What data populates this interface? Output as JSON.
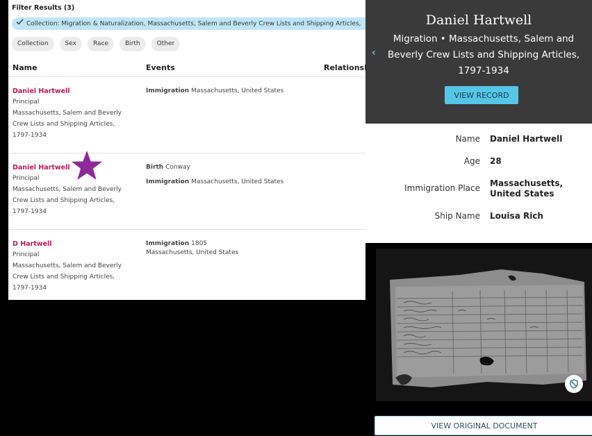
{
  "filter": {
    "title": "Filter Results (3)",
    "active_chip": "Collection: Migration & Naturalization, Massachusetts, Salem and Beverly Crew Lists and Shipping Articles,",
    "chips": [
      "Collection",
      "Sex",
      "Race",
      "Birth",
      "Other"
    ]
  },
  "columns": {
    "name": "Name",
    "events": "Events",
    "relationship": "Relationsh"
  },
  "results": [
    {
      "name": "Daniel Hartwell",
      "role": "Principal",
      "collection_lines": [
        "Massachusetts, Salem and Beverly",
        "Crew Lists and Shipping Articles,",
        "1797-1934"
      ],
      "events": [
        {
          "type": "Immigration",
          "detail": "Massachusetts, United States"
        }
      ]
    },
    {
      "name": "Daniel Hartwell",
      "role": "Principal",
      "collection_lines": [
        "Massachusetts, Salem and Beverly",
        "Crew Lists and Shipping Articles,",
        "1797-1934"
      ],
      "events": [
        {
          "type": "Birth",
          "detail": "Conway"
        },
        {
          "type": "Immigration",
          "detail": "Massachusetts, United States"
        }
      ]
    },
    {
      "name": "D Hartwell",
      "role": "Principal",
      "collection_lines": [
        "Massachusetts, Salem and Beverly",
        "Crew Lists and Shipping Articles,",
        "1797-1934"
      ],
      "events": [
        {
          "type": "Immigration",
          "detail": "1805",
          "detail2": "Massachusetts, United States"
        }
      ]
    }
  ],
  "record": {
    "title": "Daniel Hartwell",
    "subtitle": "Migration • Massachusetts, Salem and Beverly Crew Lists and Shipping Articles, 1797-1934",
    "view_record": "VIEW RECORD",
    "fields": [
      {
        "label": "Name",
        "value": "Daniel Hartwell"
      },
      {
        "label": "Age",
        "value": "28"
      },
      {
        "label": "Immigration Place",
        "value": "Massachusetts, United States"
      },
      {
        "label": "Ship Name",
        "value": "Louisa Rich"
      }
    ],
    "view_original": "VIEW ORIGINAL DOCUMENT"
  },
  "colors": {
    "name_link": "#c2185b",
    "accent": "#54c6e8",
    "star": "#8e2a98",
    "header_bg": "#3a3a3a"
  },
  "icons": [
    "check-icon",
    "star-icon",
    "chevron-left-icon",
    "shield-icon"
  ]
}
